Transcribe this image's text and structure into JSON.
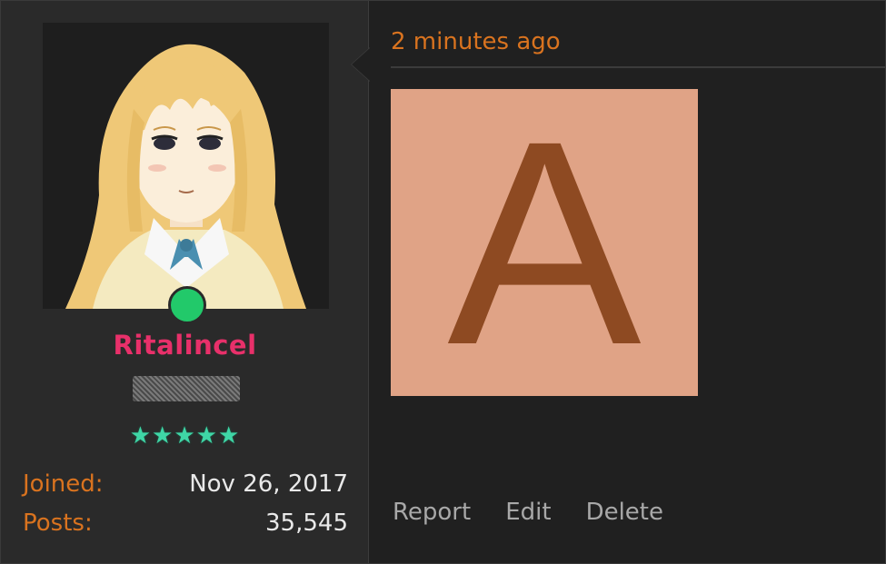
{
  "user": {
    "username": "Ritalincel",
    "stars": "★★★★★",
    "avatar_icon": "anime-girl-avatar",
    "online_color": "#22c96a",
    "stats": [
      {
        "label": "Joined:",
        "value": "Nov 26, 2017"
      },
      {
        "label": "Posts:",
        "value": "35,545"
      }
    ]
  },
  "post": {
    "timestamp": "2 minutes ago",
    "image_letter": "A",
    "actions": {
      "report": "Report",
      "edit": "Edit",
      "delete": "Delete"
    }
  },
  "colors": {
    "username": "#e8306a",
    "accent_orange": "#d9731f",
    "stars": "#3fd6a6",
    "image_bg": "#e0a386",
    "image_letter": "#8e4a22"
  }
}
